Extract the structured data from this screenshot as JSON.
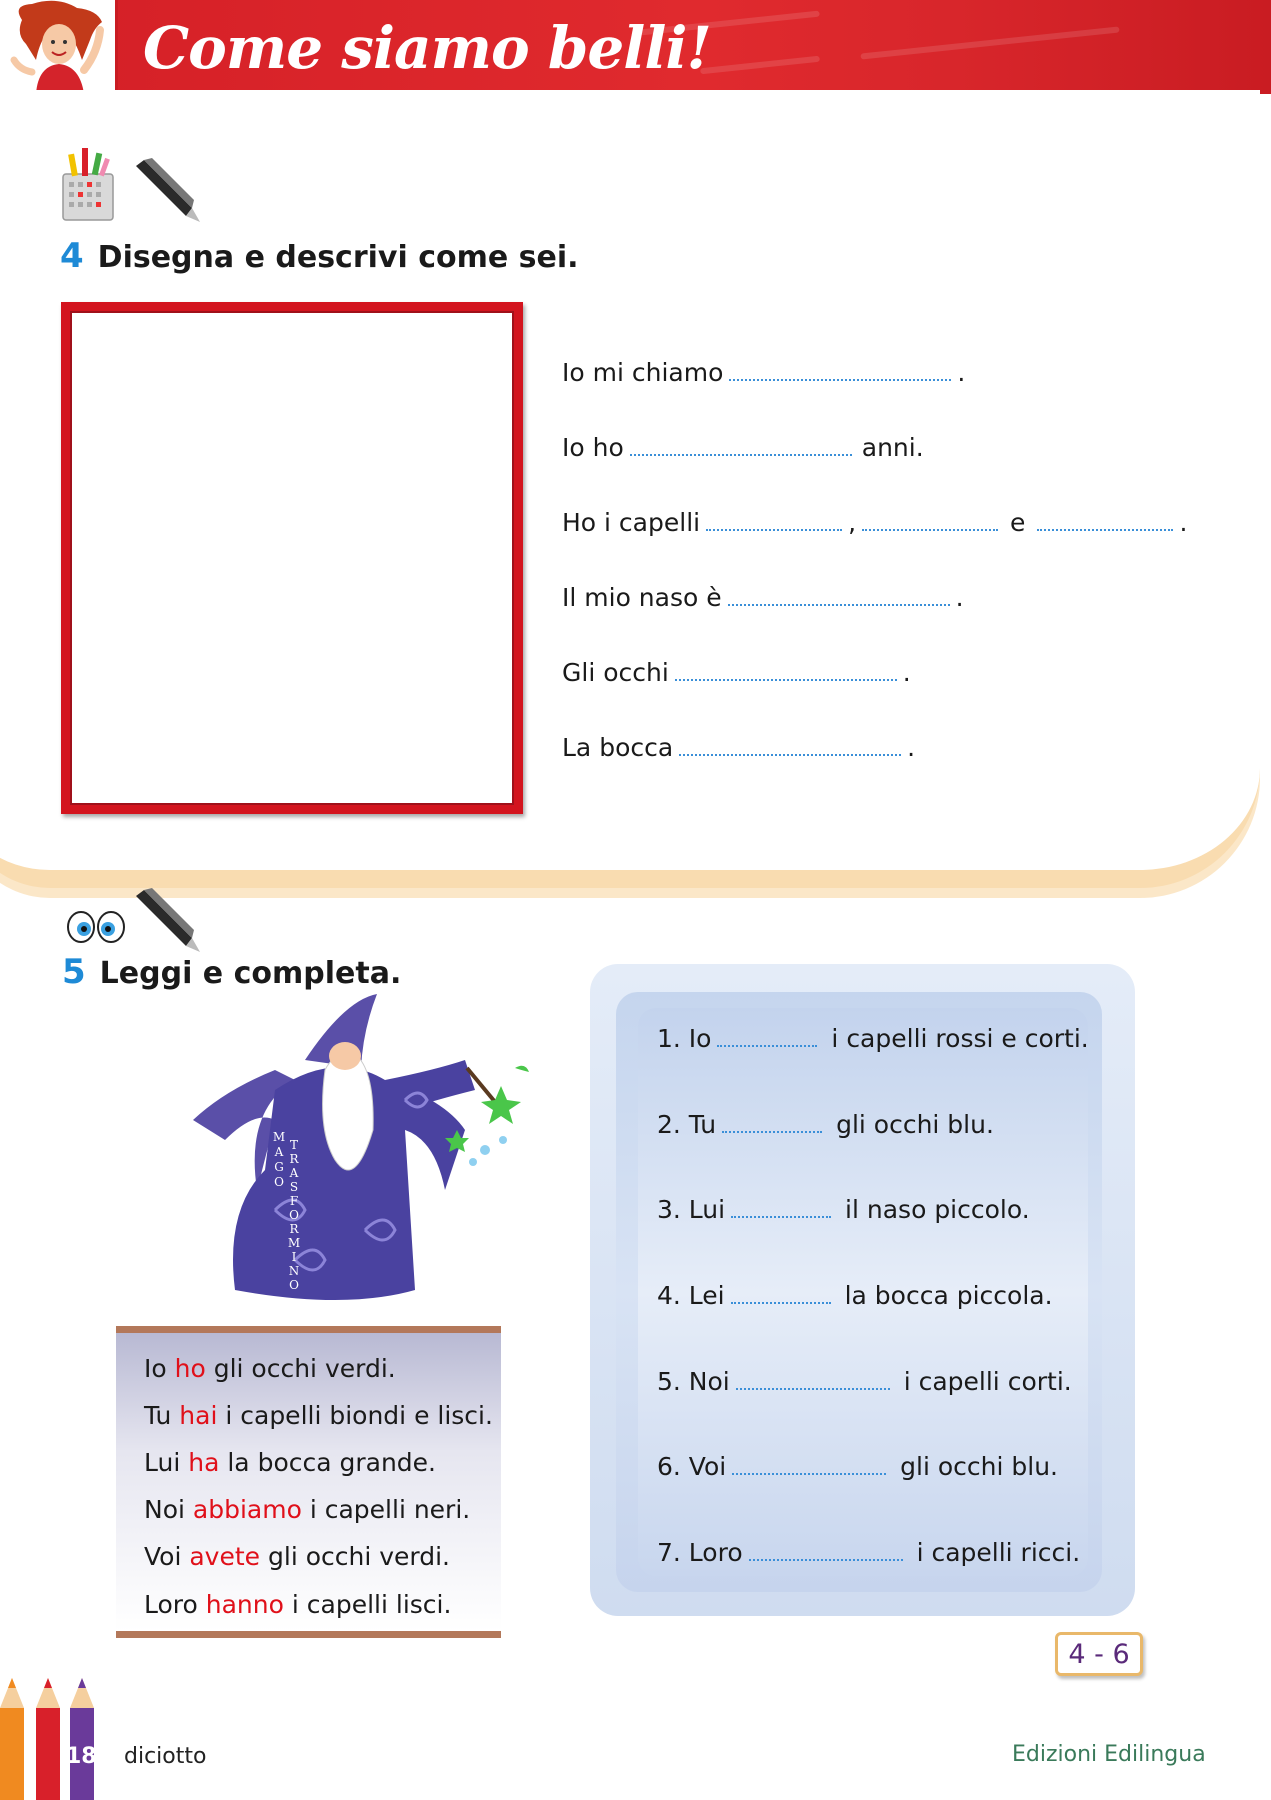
{
  "header": {
    "title": "Come siamo belli!"
  },
  "exercise4": {
    "number": "4",
    "instruction": "Disegna e descrivi come sei.",
    "lines": [
      {
        "before": "Io mi chiamo",
        "after": "."
      },
      {
        "before": "Io ho",
        "after": "anni."
      },
      {
        "before": "Ho i capelli",
        "sep1": ",",
        "sep2": "e",
        "after": "."
      },
      {
        "before": "Il mio naso è",
        "after": "."
      },
      {
        "before": "Gli occhi",
        "after": "."
      },
      {
        "before": "La bocca",
        "after": "."
      }
    ]
  },
  "exercise5": {
    "number": "5",
    "instruction": "Leggi e completa.",
    "wizard_label": [
      "MAGO",
      "TRASFORMINO"
    ],
    "grammar": [
      {
        "subject": "Io",
        "verb": "ho",
        "rest": "gli occhi verdi."
      },
      {
        "subject": "Tu",
        "verb": "hai",
        "rest": "i capelli biondi e lisci."
      },
      {
        "subject": "Lui",
        "verb": "ha",
        "rest": "la bocca grande."
      },
      {
        "subject": "Noi",
        "verb": "abbiamo",
        "rest": "i capelli neri."
      },
      {
        "subject": "Voi",
        "verb": "avete",
        "rest": "gli occhi verdi."
      },
      {
        "subject": "Loro",
        "verb": "hanno",
        "rest": "i capelli lisci."
      }
    ],
    "questions": [
      {
        "label": "1. Io",
        "rest": "i capelli rossi e corti."
      },
      {
        "label": "2. Tu",
        "rest": "gli occhi blu."
      },
      {
        "label": "3. Lui",
        "rest": "il naso piccolo."
      },
      {
        "label": "4. Lei",
        "rest": "la bocca piccola."
      },
      {
        "label": "5. Noi",
        "rest": "i capelli corti."
      },
      {
        "label": "6. Voi",
        "rest": "gli occhi blu."
      },
      {
        "label": "7. Loro",
        "rest": "i capelli ricci."
      }
    ]
  },
  "cross_ref": "4 - 6",
  "footer": {
    "page_number": "18",
    "page_word": "diciotto",
    "publisher": "Edizioni Edilingua"
  },
  "colors": {
    "header_red": "#d41f26",
    "accent_blue": "#1e8ad6",
    "verb_red": "#e0101a",
    "panel_blue": "#cfdcf0"
  }
}
